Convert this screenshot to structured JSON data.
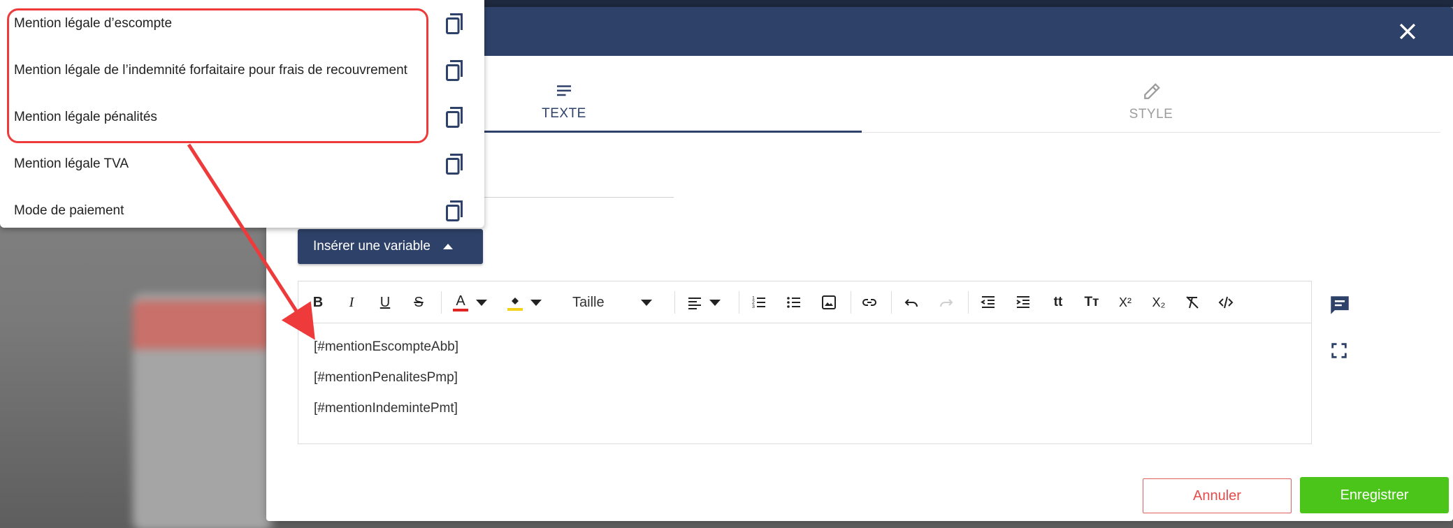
{
  "dropdown": {
    "items": [
      {
        "label": "Mention légale d’escompte"
      },
      {
        "label": "Mention légale de l’indemnité forfaitaire pour frais de recouvrement"
      },
      {
        "label": "Mention légale pénalités"
      },
      {
        "label": "Mention légale TVA"
      },
      {
        "label": "Mode de paiement"
      }
    ]
  },
  "modal": {
    "tabs": [
      {
        "label": "TEXTE",
        "active": true,
        "icon": "text-lines-icon"
      },
      {
        "label": "STYLE",
        "active": false,
        "icon": "eyedropper-icon"
      }
    ],
    "insert_variable_label": "Insérer une variable",
    "toolbar": {
      "size_label": "Taille"
    },
    "editor_lines": [
      "[#mentionEscompteAbb]",
      "[#mentionPenalitesPmp]",
      "[#mentionIndemintePmt]"
    ],
    "cancel_label": "Annuler",
    "save_label": "Enregistrer"
  },
  "colors": {
    "header": "#2e4168",
    "accent_red": "#ee3a3a",
    "save_green": "#4cc51a"
  }
}
